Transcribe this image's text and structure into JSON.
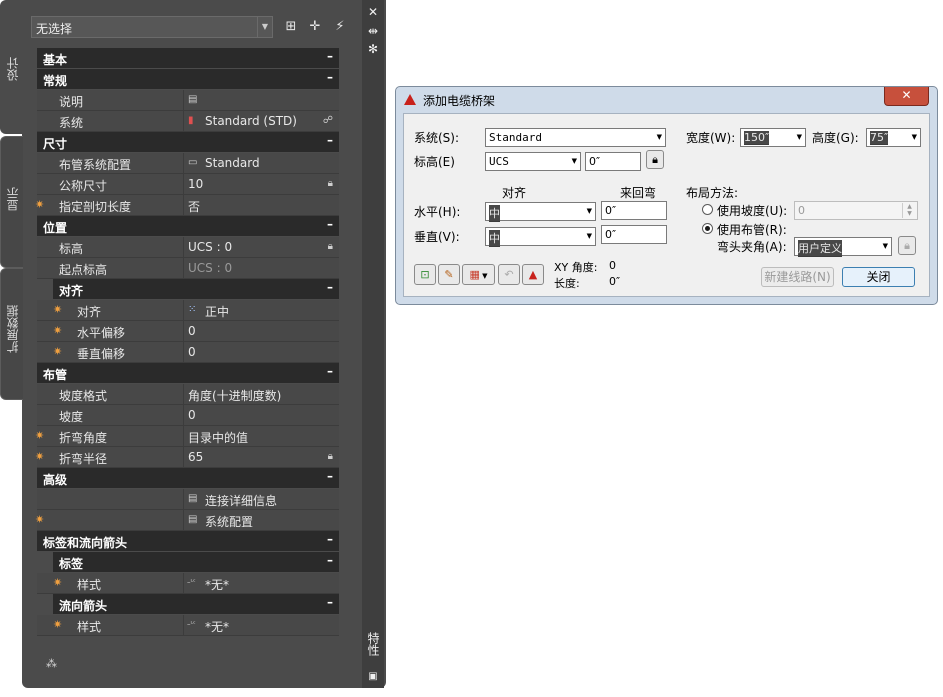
{
  "palette": {
    "tabs": {
      "design": "设计",
      "display": "显示",
      "extended": "扩展数据"
    },
    "selection": "无选择",
    "side_title": "特性",
    "sections": {
      "basic": "基本",
      "general": "常规",
      "dimensions": "尺寸",
      "location": "位置",
      "justification": "对齐",
      "routing": "布管",
      "advanced": "高级",
      "tags": "标签和流向箭头",
      "tag": "标签",
      "flow_arrow": "流向箭头"
    },
    "toggle_glyph": "–",
    "props": {
      "description": {
        "name": "说明",
        "value": ""
      },
      "system": {
        "name": "系统",
        "value": "Standard (STD)"
      },
      "routing_pref": {
        "name": "布管系统配置",
        "value": "Standard"
      },
      "nominal_size": {
        "name": "公称尺寸",
        "value": "10"
      },
      "cut_length": {
        "name": "指定剖切长度",
        "value": "否"
      },
      "elevation": {
        "name": "标高",
        "value": "UCS : 0"
      },
      "start_elevation": {
        "name": "起点标高",
        "value": "UCS : 0"
      },
      "justify": {
        "name": "对齐",
        "value": "正中"
      },
      "h_offset": {
        "name": "水平偏移",
        "value": "0"
      },
      "v_offset": {
        "name": "垂直偏移",
        "value": "0"
      },
      "slope_format": {
        "name": "坡度格式",
        "value": "角度(十进制度数)"
      },
      "slope": {
        "name": "坡度",
        "value": "0"
      },
      "bend_angle": {
        "name": "折弯角度",
        "value": "目录中的值"
      },
      "bend_radius": {
        "name": "折弯半径",
        "value": "65"
      },
      "connection_details": {
        "value": "连接详细信息"
      },
      "system_config": {
        "value": "系统配置"
      },
      "tag_style": {
        "name": "样式",
        "value": "*无*"
      },
      "arrow_style": {
        "name": "样式",
        "value": "*无*"
      }
    }
  },
  "dialog": {
    "title": "添加电缆桥架",
    "close_glyph": "✕",
    "system_label": "系统(S):",
    "system_value": "Standard",
    "width_label": "宽度(W):",
    "width_value": "150″",
    "height_label": "高度(G):",
    "height_value": "75″",
    "elevation_label": "标高(E)",
    "elevation_mode": "UCS",
    "elevation_value": "0″",
    "justify_header": "对齐",
    "rise_run_header": "来回弯",
    "horizontal_label": "水平(H):",
    "horizontal_value": "中",
    "horizontal_offset": "0″",
    "vertical_label": "垂直(V):",
    "vertical_value": "中",
    "vertical_offset": "0″",
    "layout_label": "布局方法:",
    "use_slope_label": "使用坡度(U):",
    "slope_value": "0",
    "use_routing_label": "使用布管(R):",
    "bend_angle_label": "弯头夹角(A):",
    "bend_angle_value": "用户定义",
    "xy_angle_label": "XY 角度:",
    "xy_angle_value": "0",
    "length_label": "长度:",
    "length_value": "0″",
    "new_run_button": "新建线路(N)",
    "close_button": "关闭"
  }
}
